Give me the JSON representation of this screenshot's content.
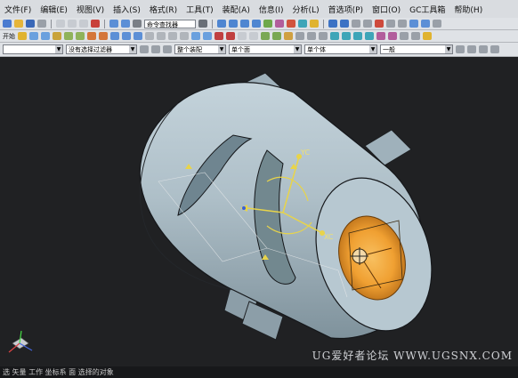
{
  "menubar": {
    "items": [
      "文件(F)",
      "编辑(E)",
      "视图(V)",
      "插入(S)",
      "格式(R)",
      "工具(T)",
      "装配(A)",
      "信息(I)",
      "分析(L)",
      "首选项(P)",
      "窗口(O)",
      "GC工具箱",
      "帮助(H)"
    ]
  },
  "toolbar": {
    "search_placeholder": "命令查找器",
    "start_label": "开始",
    "filter_dropdown": "没有选择过滤器",
    "assembly_dropdown": "整个装配",
    "plane_dropdown": "单个面",
    "body_dropdown": "单个体",
    "view_dropdown": "一般"
  },
  "viewport": {
    "watermark": "UG爱好者论坛  WWW.UGSNX.COM",
    "csys_x": "XC",
    "csys_y": "YC"
  },
  "statusbar": {
    "text": "选 矢量 工作 坐标系 面 选择的对象"
  },
  "colors": {
    "background": "#202123",
    "part": "#a9bcc6",
    "highlight": "#f2a53a",
    "csys_yellow": "#e8d44a"
  }
}
